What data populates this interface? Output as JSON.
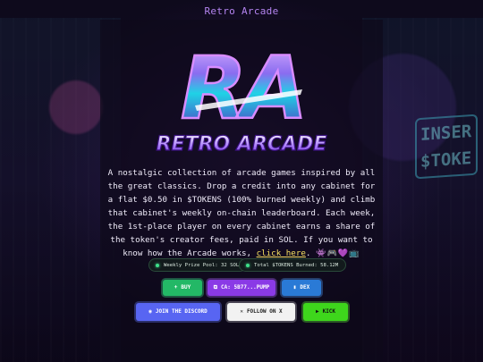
{
  "header": {
    "title": "Retro Arcade"
  },
  "logo": {
    "monogram": "RA",
    "wordmark": "RETRO ARCADE"
  },
  "background": {
    "insert_sign": [
      "INSER",
      "$TOKE"
    ]
  },
  "description": {
    "text": "A nostalgic collection of arcade games inspired by all the great classics. Drop a credit into any cabinet for a flat $0.50 in $TOKENS (100% burned weekly) and climb that cabinet's weekly on-chain leaderboard. Each week, the 1st-place player on every cabinet earns a share of the token's creator fees, paid in SOL. If you want to know how the Arcade works, ",
    "link": "click here",
    "after_link": ".",
    "emojis": "👾🎮💜📺"
  },
  "stats": {
    "weekly_prize": "Weekly Prize Pool: 32 SOL",
    "tokens_burned": "Total $TOKENS Burned: 58.12M"
  },
  "buttons": {
    "buy": "BUY",
    "ca": "CA: 5B77...PUMP",
    "dex": "DEX",
    "discord": "JOIN THE DISCORD",
    "x": "FOLLOW ON X",
    "kick": "KICK"
  },
  "colors": {
    "accent": "#b484f0",
    "link": "#f6e060",
    "buy": "#23b866",
    "ca": "#8a3ae6",
    "dex": "#2a7ad6",
    "discord": "#5865f2",
    "kick": "#3ed61c"
  }
}
